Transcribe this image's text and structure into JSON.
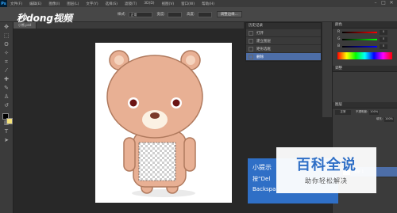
{
  "app": {
    "logo": "Ps"
  },
  "menubar": {
    "items": [
      "文件(F)",
      "编辑(E)",
      "图像(I)",
      "图层(L)",
      "文字(Y)",
      "选择(S)",
      "滤镜(T)",
      "3D(D)",
      "视图(V)",
      "窗口(W)",
      "帮助(H)"
    ]
  },
  "window_controls": [
    "–",
    "□",
    "✕"
  ],
  "options": {
    "style_label": "样式:",
    "style_value": "正常",
    "width_label": "宽度:",
    "height_label": "高度:",
    "refine_button": "调整边缘..."
  },
  "doc_tab": {
    "label": "小熊.psd"
  },
  "history": {
    "title": "历史记录",
    "items": [
      "打开",
      "建立图层",
      "矩形选框",
      "删除"
    ]
  },
  "color": {
    "title": "颜色",
    "channels": [
      {
        "name": "R",
        "value": "0"
      },
      {
        "name": "G",
        "value": "0"
      },
      {
        "name": "B",
        "value": "0"
      }
    ]
  },
  "adjust": {
    "title": "调整"
  },
  "layers": {
    "title": "图层",
    "blend_mode": "正常",
    "opacity_label": "不透明度:",
    "opacity_value": "100%",
    "fill_label": "填充:",
    "fill_value": "100%",
    "rows": [
      {
        "name": "图层 1",
        "active": true
      }
    ]
  },
  "tip": {
    "title": "小提示",
    "line2": "按“Del",
    "line3": "Backspa"
  },
  "logo": {
    "main": "百科全说",
    "sub": "助你轻松解决"
  },
  "watermark": {
    "text": "秒dong视频"
  },
  "colors": {
    "accent": "#4d6ea8",
    "tip_bg": "#2f6fc6",
    "bear_body": "#e8b094",
    "bear_outline": "#b07a5e"
  }
}
